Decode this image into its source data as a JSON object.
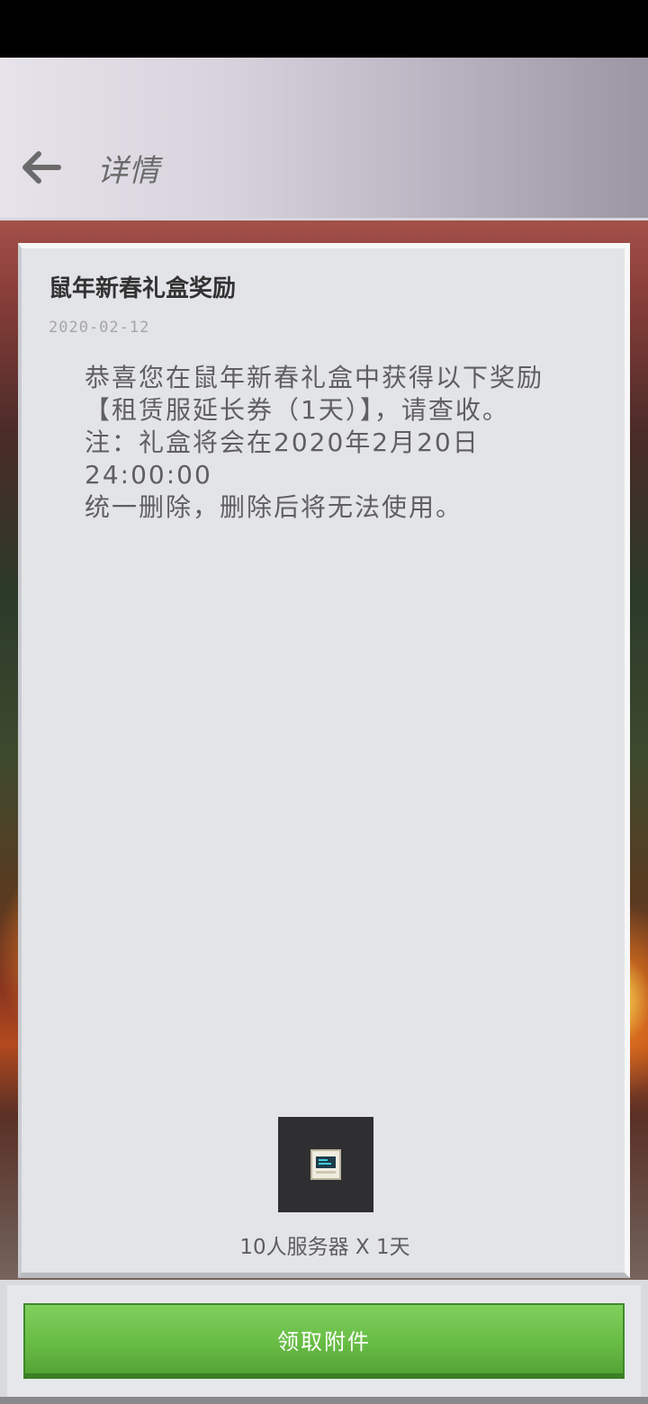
{
  "header": {
    "title": "详情",
    "back_icon": "arrow-left-icon"
  },
  "mail": {
    "title": "鼠年新春礼盒奖励",
    "date": "2020-02-12",
    "body_lines": [
      "恭喜您在鼠年新春礼盒中获得以下奖励",
      "【租赁服延长券（1天）】，请查收。",
      "注：礼盒将会在2020年2月20日24:00:00",
      "统一删除，删除后将无法使用。"
    ]
  },
  "attachment": {
    "icon": "server-icon",
    "label": "10人服务器 X 1天"
  },
  "footer": {
    "claim_label": "领取附件",
    "accent": "#68bd45"
  }
}
